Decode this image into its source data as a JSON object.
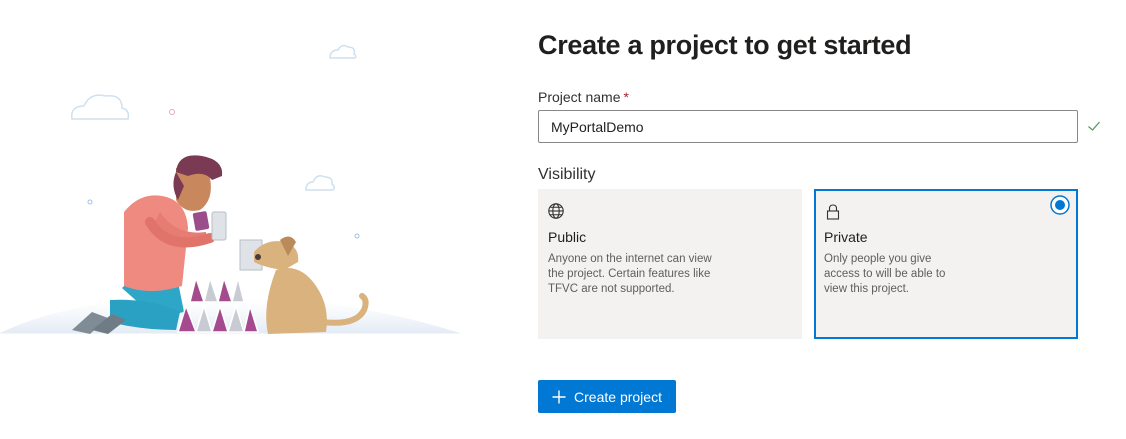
{
  "page": {
    "title": "Create a project to get started"
  },
  "project_name": {
    "label": "Project name",
    "required_mark": "*",
    "value": "MyPortalDemo",
    "valid": true
  },
  "visibility": {
    "label": "Visibility",
    "selected": "private",
    "options": [
      {
        "id": "public",
        "icon": "globe-icon",
        "name": "Public",
        "description": "Anyone on the internet can view the project. Certain features like TFVC are not supported."
      },
      {
        "id": "private",
        "icon": "lock-icon",
        "name": "Private",
        "description": "Only people you give access to will be able to view this project."
      }
    ]
  },
  "create_button": {
    "icon": "plus-icon",
    "label": "Create project"
  },
  "colors": {
    "accent": "#0078d4",
    "valid_check": "#5b9a68",
    "required": "#a4262c"
  }
}
